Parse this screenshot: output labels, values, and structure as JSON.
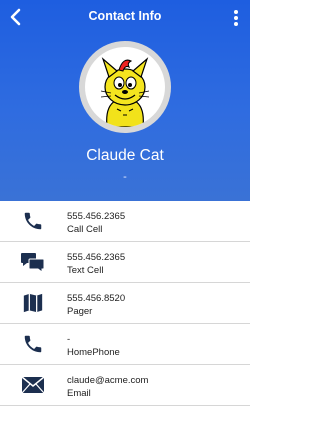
{
  "header": {
    "title": "Contact Info",
    "back_icon": "chevron-left-icon",
    "menu_icon": "vertical-ellipsis-icon",
    "name": "Claude Cat",
    "subtitle": "-",
    "colors": {
      "gradient_top": "#1e5ee0",
      "gradient_bottom": "#3a72d6"
    }
  },
  "contacts": [
    {
      "value": "555.456.2365",
      "label": "Call Cell",
      "icon": "phone-icon"
    },
    {
      "value": "555.456.2365",
      "label": "Text Cell",
      "icon": "chat-bubbles-icon"
    },
    {
      "value": "555.456.8520",
      "label": "Pager",
      "icon": "map-icon"
    },
    {
      "value": "-",
      "label": "HomePhone",
      "icon": "phone-icon"
    },
    {
      "value": "claude@acme.com",
      "label": "Email",
      "icon": "envelope-icon"
    }
  ],
  "colors": {
    "icon": "#1c2f4f",
    "divider": "#d6d6d6"
  }
}
